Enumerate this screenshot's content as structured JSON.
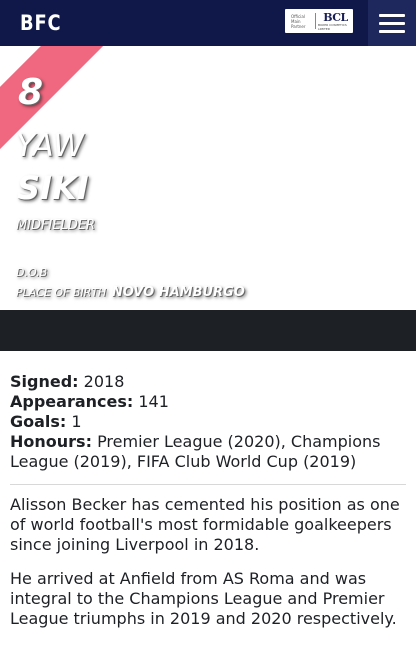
{
  "header": {
    "logo_text": "BFC",
    "partner": {
      "small_text": "Official Main Partner",
      "mark_text": "BCL",
      "mark_sub": "BOXER COSMETICS LIMITED"
    },
    "menu_icon": "hamburger-menu-icon"
  },
  "player": {
    "number": "8",
    "first_name": "YAW",
    "last_name": "SIKI",
    "position": "MIDFIELDER",
    "dob_label": "D.O.B",
    "pob_label": "PLACE OF BIRTH",
    "pob_value": "NOVO HAMBURGO"
  },
  "stats": {
    "signed_label": "Signed:",
    "signed_value": "2018",
    "appearances_label": "Appearances:",
    "appearances_value": "141",
    "goals_label": "Goals:",
    "goals_value": "1",
    "honours_label": "Honours:",
    "honours_value": "Premier League (2020), Champions League (2019), FIFA Club World Cup (2019)"
  },
  "bio": {
    "p1": "Alisson Becker has cemented his position as one of world football's most formidable goalkeepers since joining Liverpool in 2018.",
    "p2": "He arrived at Anfield from AS Roma and was integral to the Champions League and Premier League triumphs in 2019 and 2020 respectively."
  },
  "colors": {
    "header": "#10184a",
    "menu_button": "#1f285d",
    "ribbon": "#f0687f",
    "bar": "#1d2025"
  }
}
